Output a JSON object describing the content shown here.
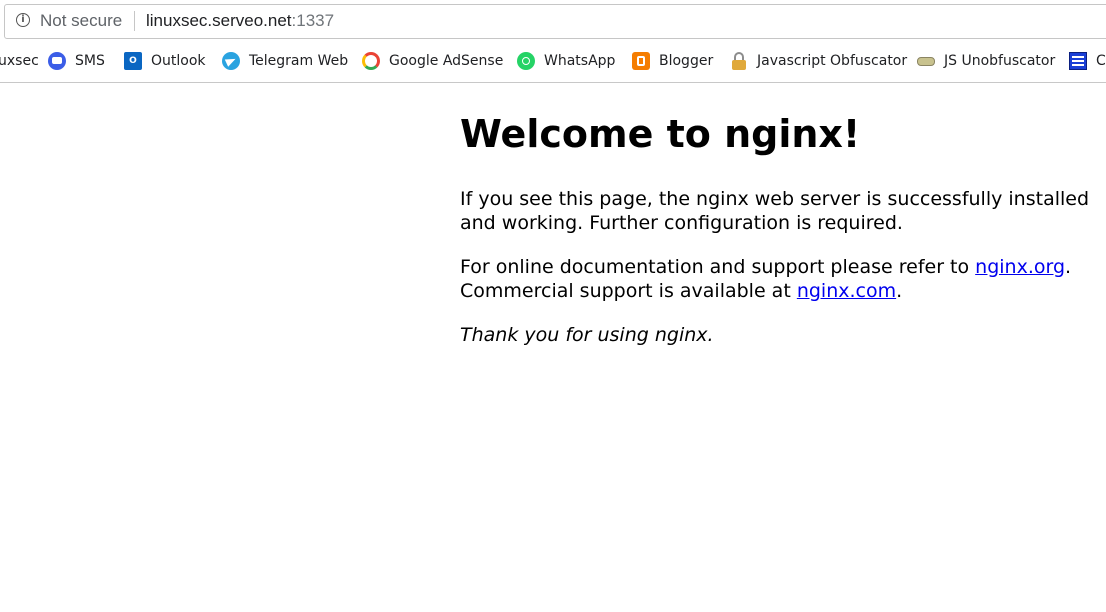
{
  "address_bar": {
    "security_label": "Not secure",
    "url_host": "linuxsec.serveo.net",
    "url_port": ":1337"
  },
  "bookmarks": [
    {
      "label": "uxsec",
      "icon": "none"
    },
    {
      "label": "SMS",
      "icon": "sms-icon"
    },
    {
      "label": "Outlook",
      "icon": "outlook-icon"
    },
    {
      "label": "Telegram Web",
      "icon": "telegram-icon"
    },
    {
      "label": "Google AdSense",
      "icon": "google-icon"
    },
    {
      "label": "WhatsApp",
      "icon": "whatsapp-icon"
    },
    {
      "label": "Blogger",
      "icon": "blogger-icon"
    },
    {
      "label": "Javascript Obfuscator",
      "icon": "lock-icon"
    },
    {
      "label": "JS Unobfuscator",
      "icon": "unobfuscator-icon"
    },
    {
      "label": "C",
      "icon": "tools-icon"
    }
  ],
  "page": {
    "heading": "Welcome to nginx!",
    "para1": "If you see this page, the nginx web server is successfully installed and working. Further configuration is required.",
    "para2_prefix": "For online documentation and support please refer to ",
    "link_org": "nginx.org",
    "para2_mid": ".",
    "para2_line2": "Commercial support is available at ",
    "link_com": "nginx.com",
    "para2_suffix": ".",
    "thanks": "Thank you for using nginx."
  },
  "colors": {
    "link": "#0000ee",
    "chrome_border": "#c6c6c6",
    "security_text": "#5f6368"
  }
}
